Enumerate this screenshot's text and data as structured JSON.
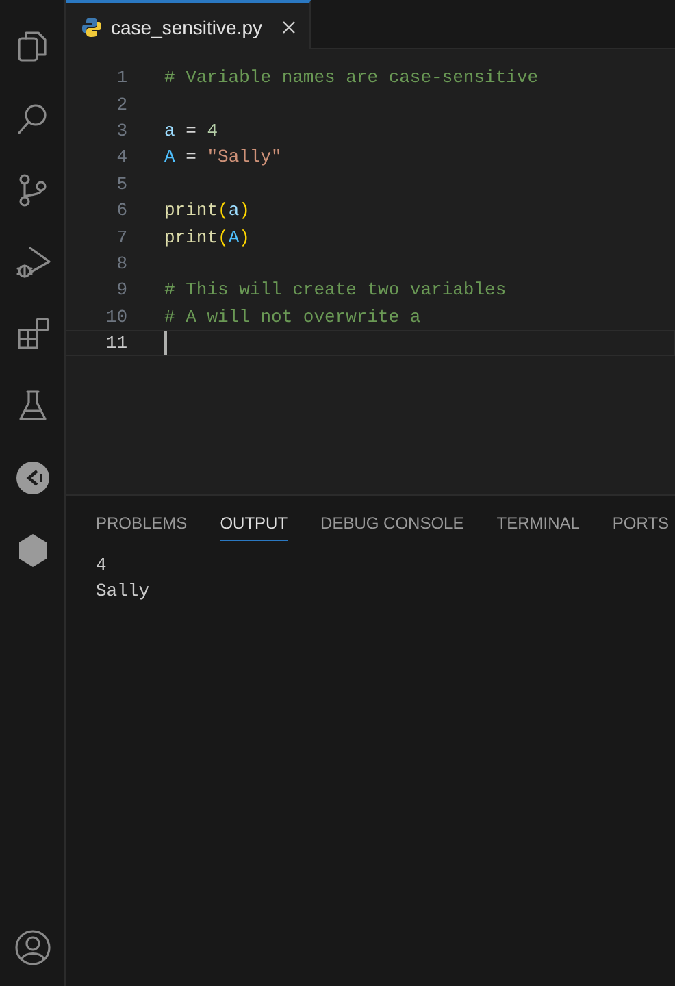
{
  "editor_tab": {
    "title": "case_sensitive.py",
    "selected": true
  },
  "lines": [
    {
      "number": "1",
      "current": false,
      "tokens": [
        {
          "kind": "comment",
          "text": "# Variable names are case-sensitive"
        }
      ]
    },
    {
      "number": "2",
      "current": false
    },
    {
      "number": "3",
      "current": false,
      "tokens": [
        {
          "kind": "var",
          "text": "a"
        },
        {
          "kind": "op",
          "text": " = "
        },
        {
          "kind": "num",
          "text": "4"
        }
      ]
    },
    {
      "number": "4",
      "current": false,
      "tokens": [
        {
          "kind": "const",
          "text": "A"
        },
        {
          "kind": "op",
          "text": " = "
        },
        {
          "kind": "str",
          "text": "\"Sally\""
        }
      ]
    },
    {
      "number": "5",
      "current": false
    },
    {
      "number": "6",
      "current": false,
      "tokens": [
        {
          "kind": "func",
          "text": "print"
        },
        {
          "kind": "paren",
          "text": "("
        },
        {
          "kind": "var",
          "text": "a"
        },
        {
          "kind": "paren",
          "text": ")"
        }
      ]
    },
    {
      "number": "7",
      "current": false,
      "tokens": [
        {
          "kind": "func",
          "text": "print"
        },
        {
          "kind": "paren",
          "text": "("
        },
        {
          "kind": "const",
          "text": "A"
        },
        {
          "kind": "paren",
          "text": ")"
        }
      ]
    },
    {
      "number": "8",
      "current": false
    },
    {
      "number": "9",
      "current": false,
      "tokens": [
        {
          "kind": "comment",
          "text": "# This will create two variables"
        }
      ]
    },
    {
      "number": "10",
      "current": false,
      "tokens": [
        {
          "kind": "comment",
          "text": "# A will not overwrite a"
        }
      ]
    },
    {
      "number": "11",
      "current": true
    }
  ],
  "panel": {
    "tabs": [
      {
        "label": "PROBLEMS",
        "selected": false
      },
      {
        "label": "OUTPUT",
        "selected": true
      },
      {
        "label": "DEBUG CONSOLE",
        "selected": false
      },
      {
        "label": "TERMINAL",
        "selected": false
      },
      {
        "label": "PORTS",
        "selected": false
      }
    ],
    "output": [
      "4",
      "Sally"
    ]
  }
}
